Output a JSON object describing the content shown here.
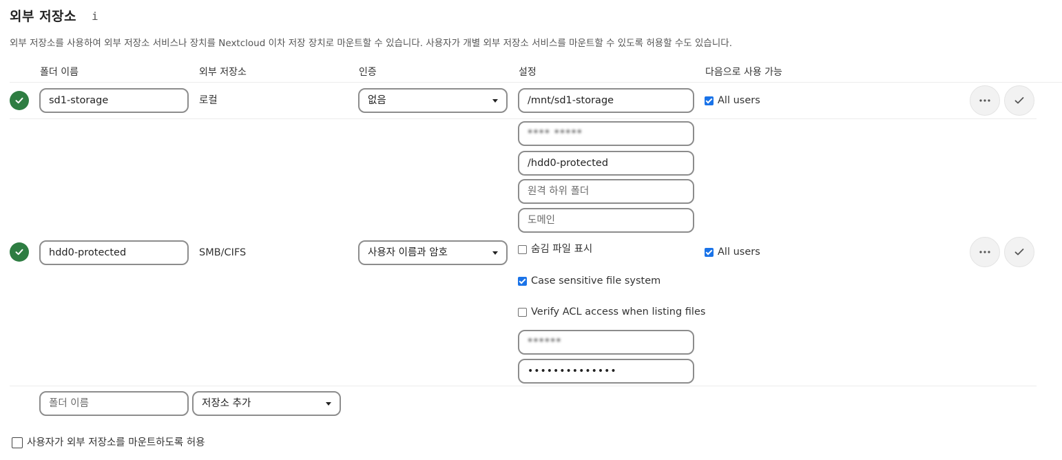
{
  "header": {
    "title": "외부 저장소",
    "info_glyph": "i",
    "description": "외부 저장소를 사용하여 외부 저장소 서비스나 장치를 Nextcloud 이차 저장 장치로 마운트할 수 있습니다. 사용자가 개별 외부 저장소 서비스를 마운트할 수 있도록 허용할 수도 있습니다."
  },
  "columns": {
    "folder_name": "폴더 이름",
    "external_storage": "외부 저장소",
    "authentication": "인증",
    "configuration": "설정",
    "available_for": "다음으로 사용 가능"
  },
  "mounts": [
    {
      "status": "ok",
      "folder_name": "sd1-storage",
      "backend": "로컬",
      "auth": "없음",
      "config": {
        "datadir": "/mnt/sd1-storage"
      },
      "applicable": "All users",
      "applicable_checked": true
    },
    {
      "status": "ok",
      "folder_name": "hdd0-protected",
      "backend": "SMB/CIFS",
      "auth": "사용자 이름과 암호",
      "config": {
        "host": "**** *****",
        "share": "/hdd0-protected",
        "root_placeholder": "원격 하위 폴더",
        "domain_placeholder": "도메인",
        "show_hidden_label": "숨김 파일 표시",
        "show_hidden_checked": false,
        "case_sensitive_label": "Case sensitive file system",
        "case_sensitive_checked": true,
        "check_acl_label": "Verify ACL access when listing files",
        "check_acl_checked": false,
        "user": "******",
        "password": "••••••••••••••"
      },
      "applicable": "All users",
      "applicable_checked": true
    }
  ],
  "new_mount": {
    "folder_placeholder": "폴더 이름",
    "add_storage_label": "저장소 추가"
  },
  "footer": {
    "allow_user_mounting_label": "사용자가 외부 저장소를 마운트하도록 허용",
    "allow_user_mounting_checked": false
  },
  "icons": {
    "status": "check-icon",
    "more": "more-horizontal-icon",
    "save": "check-icon",
    "dropdown": "caret-down-icon"
  },
  "colors": {
    "status_ok": "#2e7d42",
    "checkbox_checked": "#1a73e8",
    "input_border": "#8c8c8c"
  }
}
